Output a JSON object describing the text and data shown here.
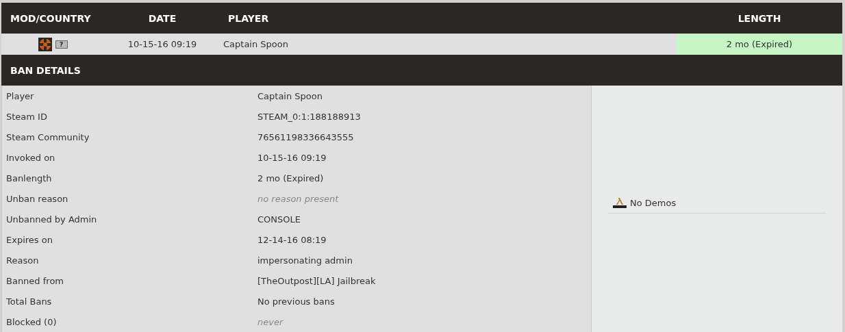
{
  "table": {
    "columns": [
      {
        "label": "MOD/COUNTRY"
      },
      {
        "label": "DATE"
      },
      {
        "label": "PLAYER"
      },
      {
        "label": "LENGTH"
      }
    ],
    "row": {
      "date": "10-15-16 09:19",
      "player": "Captain Spoon",
      "length": "2 mo (Expired)",
      "expired": true,
      "country": "?"
    }
  },
  "ban_details": {
    "title": "BAN DETAILS",
    "rows": [
      {
        "label": "Player",
        "value": "Captain Spoon",
        "italic": false
      },
      {
        "label": "Steam ID",
        "value": "STEAM_0:1:188188913",
        "italic": false
      },
      {
        "label": "Steam Community",
        "value": "76561198336643555",
        "italic": false
      },
      {
        "label": "Invoked on",
        "value": "10-15-16 09:19",
        "italic": false
      },
      {
        "label": "Banlength",
        "value": "2 mo (Expired)",
        "italic": false
      },
      {
        "label": "Unban reason",
        "value": "no reason present",
        "italic": true
      },
      {
        "label": "Unbanned by Admin",
        "value": "CONSOLE",
        "italic": false
      },
      {
        "label": "Expires on",
        "value": "12-14-16 08:19",
        "italic": false
      },
      {
        "label": "Reason",
        "value": "impersonating admin",
        "italic": false
      },
      {
        "label": "Banned from",
        "value": "[TheOutpost][LA] Jailbreak",
        "italic": false
      },
      {
        "label": "Total Bans",
        "value": "No previous bans",
        "italic": false
      },
      {
        "label": "Blocked (0)",
        "value": "never",
        "italic": true
      }
    ],
    "demos": "No Demos"
  }
}
